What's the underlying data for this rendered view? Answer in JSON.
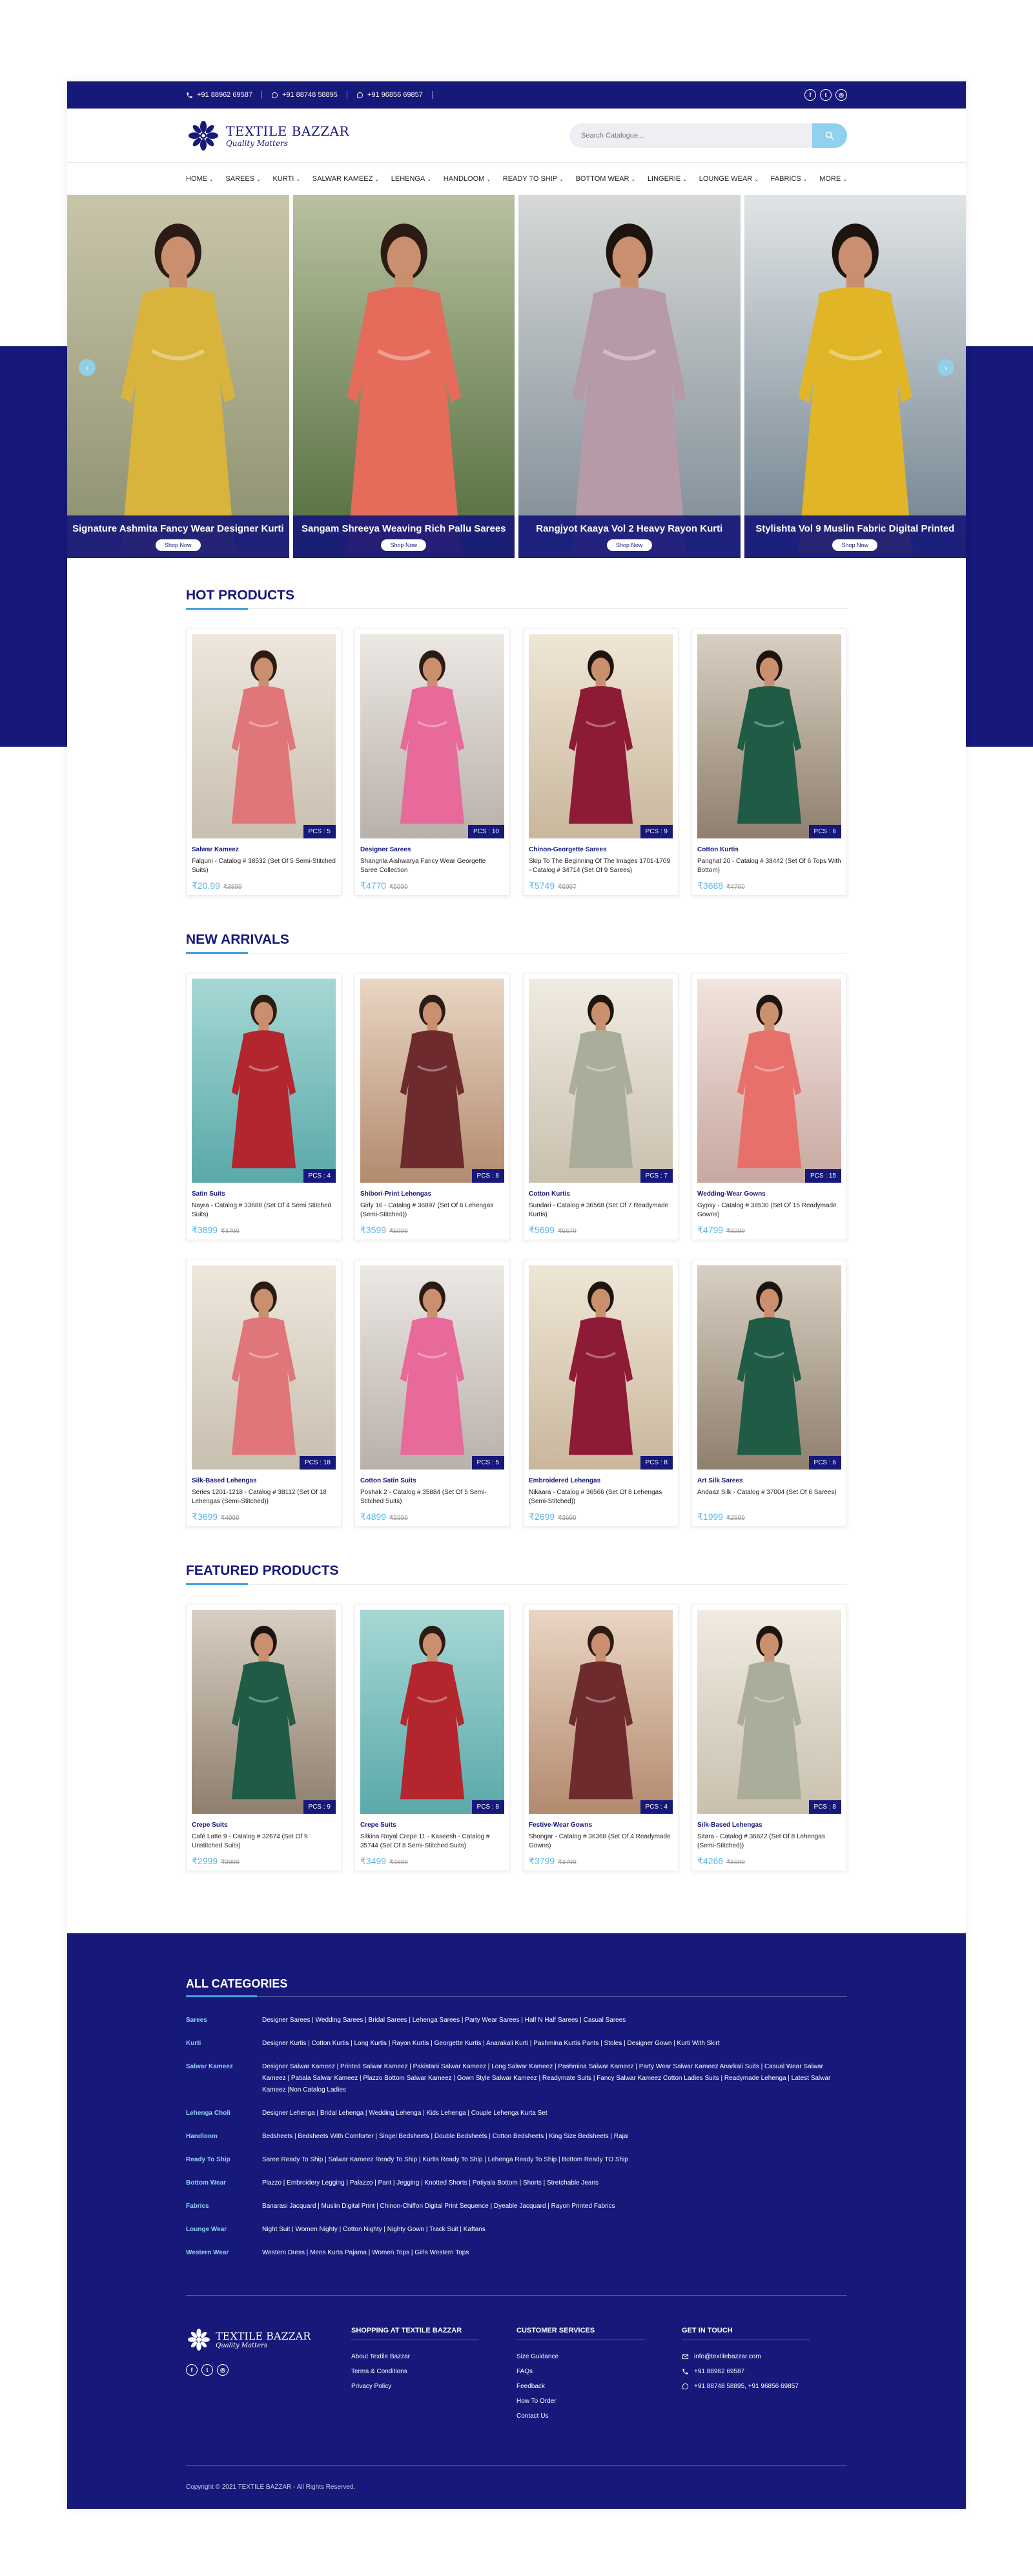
{
  "colors": {
    "brand": "#16187a",
    "accent": "#3fa3e0",
    "price": "#5bb8e8",
    "search_button": "#8fd1ef"
  },
  "topbar": {
    "phones": [
      {
        "icon": "phone-icon",
        "text": "+91 88962 69587"
      },
      {
        "icon": "whatsapp-icon",
        "text": "+91 88748 58895"
      },
      {
        "icon": "whatsapp-icon",
        "text": "+91 96856 69857"
      }
    ],
    "socials": [
      "facebook-icon",
      "twitter-icon",
      "instagram-icon"
    ]
  },
  "header": {
    "logo_name": "TEXTILE BAZZAR",
    "logo_tagline": "Quality Matters",
    "search_placeholder": "Search Catalogue..."
  },
  "nav": [
    {
      "label": "HOME"
    },
    {
      "label": "SAREES"
    },
    {
      "label": "KURTI"
    },
    {
      "label": "SALWAR KAMEEZ"
    },
    {
      "label": "LEHENGA"
    },
    {
      "label": "HANDLOOM"
    },
    {
      "label": "READY TO SHIP"
    },
    {
      "label": "BOTTOM WEAR"
    },
    {
      "label": "LINGERIE"
    },
    {
      "label": "LOUNGE WEAR"
    },
    {
      "label": "FABRICS"
    },
    {
      "label": "MORE"
    }
  ],
  "hero": {
    "slides": [
      {
        "title": "Signature Ashmita Fancy Wear Designer Kurti",
        "button": "Shop Now"
      },
      {
        "title": "Sangam Shreeya Weaving Rich Pallu Sarees",
        "button": "Shop Now"
      },
      {
        "title": "Rangjyot Kaaya Vol 2 Heavy Rayon Kurti",
        "button": "Shop Now"
      },
      {
        "title": "Stylishta Vol 9 Muslin Fabric Digital Printed",
        "button": "Shop Now"
      }
    ]
  },
  "hot_products": {
    "title": "HOT PRODUCTS",
    "items": [
      {
        "category": "Salwar Kameez",
        "name": "Falguni - Catalog # 38532 (Set Of 5 Semi-Stitched Suits)",
        "price": "₹20.99",
        "old_price": "₹3899",
        "pcs": "PCS : 5"
      },
      {
        "category": "Designer Sarees",
        "name": "Shangrila Aishwarya Fancy Wear Georgette Saree Collection",
        "price": "₹4770",
        "old_price": "₹5990",
        "pcs": "PCS : 10"
      },
      {
        "category": "Chinon-Georgette Sarees",
        "name": "Skip To The Beginning Of The Images 1701-1709 - Catalog # 34714 (Set Of 9 Sarees)",
        "price": "₹5749",
        "old_price": "₹6997",
        "pcs": "PCS : 9"
      },
      {
        "category": "Cotton Kurtis",
        "name": "Panghat 20 - Catalog # 38442 (Set Of 6 Tops With Bottom)",
        "price": "₹3688",
        "old_price": "₹4760",
        "pcs": "PCS : 6"
      }
    ]
  },
  "new_arrivals": {
    "title": "NEW ARRIVALS",
    "items": [
      {
        "category": "Satin Suits",
        "name": "Nayra - Catalog # 33688 (Set Of 4 Semi Stitched Suits)",
        "price": "₹3899",
        "old_price": "₹4799",
        "pcs": "PCS : 4"
      },
      {
        "category": "Shibori-Print Lehengas",
        "name": "Girly 16 - Catalog # 36897 (Set Of 6 Lehengas (Semi-Stitched))",
        "price": "₹3599",
        "old_price": "₹5999",
        "pcs": "PCS : 6"
      },
      {
        "category": "Cotton Kurtis",
        "name": "Sundari - Catalog # 36568 (Set Of 7 Readymade Kurtis)",
        "price": "₹5699",
        "old_price": "₹6679",
        "pcs": "PCS : 7"
      },
      {
        "category": "Wedding-Wear Gowns",
        "name": "Gypsy - Catalog # 38530 (Set Of 15 Readymade Gowns)",
        "price": "₹4799",
        "old_price": "₹6299",
        "pcs": "PCS : 15"
      },
      {
        "category": "Silk-Based Lehengas",
        "name": "Series 1201-1218 - Catalog # 38112 (Set Of 18 Lehengas (Semi-Stitched))",
        "price": "₹3699",
        "old_price": "₹4999",
        "pcs": "PCS : 18"
      },
      {
        "category": "Cotton Satin Suits",
        "name": "Poshak 2 - Catalog # 35884 (Set Of 5 Semi-Stitched Suits)",
        "price": "₹4899",
        "old_price": "₹5999",
        "pcs": "PCS : 5"
      },
      {
        "category": "Embroidered Lehengas",
        "name": "Nikaara - Catalog # 36566 (Set Of 8 Lehengas (Semi-Stitched))",
        "price": "₹2699",
        "old_price": "₹3699",
        "pcs": "PCS : 8"
      },
      {
        "category": "Art Silk Sarees",
        "name": "Andaaz Silk - Catalog # 37004 (Set Of 6 Sarees)",
        "price": "₹1999",
        "old_price": "₹2999",
        "pcs": "PCS : 6"
      }
    ]
  },
  "featured_products": {
    "title": "FEATURED PRODUCTS",
    "items": [
      {
        "category": "Crepe Suits",
        "name": "Café Latte 9 - Catalog # 32674 (Set Of 9 Unstitched Suits)",
        "price": "₹2999",
        "old_price": "₹3999",
        "pcs": "PCS : 9"
      },
      {
        "category": "Crepe Suits",
        "name": "Silkina Royal Crepe 11 - Kaseesh - Catalog # 35744 (Set Of 8 Semi-Stitched Suits)",
        "price": "₹3499",
        "old_price": "₹4899",
        "pcs": "PCS : 8"
      },
      {
        "category": "Festive-Wear Gowns",
        "name": "Shongar - Catalog # 36368 (Set Of 4 Readymade Gowns)",
        "price": "₹3799",
        "old_price": "₹4799",
        "pcs": "PCS : 4"
      },
      {
        "category": "Silk-Based Lehengas",
        "name": "Sitara - Catalog # 36622 (Set Of 8 Lehengas (Semi-Stitched))",
        "price": "₹4266",
        "old_price": "₹5999",
        "pcs": "PCS : 8"
      }
    ]
  },
  "footer": {
    "categories_title": "ALL CATEGORIES",
    "categories": [
      {
        "name": "Sarees",
        "links": "Designer Sarees | Wedding Sarees | Bridal Sarees | Lehenga Sarees | Party Wear Sarees | Half N Half Sarees | Casual Sarees"
      },
      {
        "name": "Kurti",
        "links": "Designer Kurtis | Cotton Kurtis | Long Kurtis | Rayon Kurtis | Georgette Kurtis | Anarakali Kurti | Pashmina Kurtis Pants | Stoles | Designer Gown | Kurti With Skirt"
      },
      {
        "name": "Salwar Kameez",
        "links": "Designer Salwar Kameez | Printed Salwar Kameez | Pakistani Salwar Kameez | Long Salwar Kameez | Pashmina Salwar Kameez | Party Wear Salwar Kameez Anarkali Suits | Casual Wear Salwar Kameez | Patiala Salwar Kameez | Plazzo Bottom Salwar Kameez | Gown Style Salwar Kameez | Readymate Suits | Fancy Salwar Kameez Cotton Ladies Suits | Readymade Lehenga | Latest Salwar Kameez |Non Catalog Ladies"
      },
      {
        "name": "Lehenga Choli",
        "links": "Designer Lehenga | Bridal Lehenga | Wedding Lehenga | Kids Lehenga | Couple Lehenga Kurta Set"
      },
      {
        "name": "Handloom",
        "links": "Bedsheets | Bedsheets With Comforter | Singel Bedsheets | Double Bedsheets | Cotton Bedsheets | King Size Bedsheets | Rajai"
      },
      {
        "name": "Ready To Ship",
        "links": "Saree Ready To Ship | Salwar Kameez Ready To Ship | Kurtis Ready To Ship | Lehenga Ready To Ship | Bottom Ready TO Ship"
      },
      {
        "name": "Bottom Wear",
        "links": "Plazzo | Embroidery Legging | Palazzo | Pant | Jegging | Knotted Shorts | Patiyala Bottom | Shorts | Stretchable Jeans"
      },
      {
        "name": "Fabrics",
        "links": "Banarasi Jacquard | Muslin Digital Print | Chinon-Chiffon Digital Print Sequence | Dyeable Jacquard | Rayon Printed Fabrics"
      },
      {
        "name": "Lounge Wear",
        "links": "Night Suit | Women Nighty | Cotton Nighty | Nighty Gown | Track Suit | Kaftans"
      },
      {
        "name": "Western Wear",
        "links": "Western Dress | Mens Kurta Pajama | Women Tops | Girls Western Tops"
      }
    ],
    "logo_name": "TEXTILE BAZZAR",
    "logo_tagline": "Quality Matters",
    "shopping": {
      "title": "SHOPPING AT TEXTILE BAZZAR",
      "links": [
        "About Textile Bazzar",
        "Terms & Conditions",
        "Privacy Policy"
      ]
    },
    "customer": {
      "title": "CUSTOMER SERVICES",
      "links": [
        "Size Guidance",
        "FAQs",
        "Feedback",
        "How To Order",
        "Contact Us"
      ]
    },
    "touch": {
      "title": "GET IN TOUCH",
      "items": [
        {
          "icon": "mail-icon",
          "text": "info@textilebazzar.com"
        },
        {
          "icon": "phone-icon",
          "text": "+91 88962 69587"
        },
        {
          "icon": "whatsapp-icon",
          "text": "+91 88748 58895, +91 96856 69857"
        }
      ]
    },
    "copyright": "Copyright © 2021 TEXTILE BAZZAR - All Rights Reserved."
  }
}
